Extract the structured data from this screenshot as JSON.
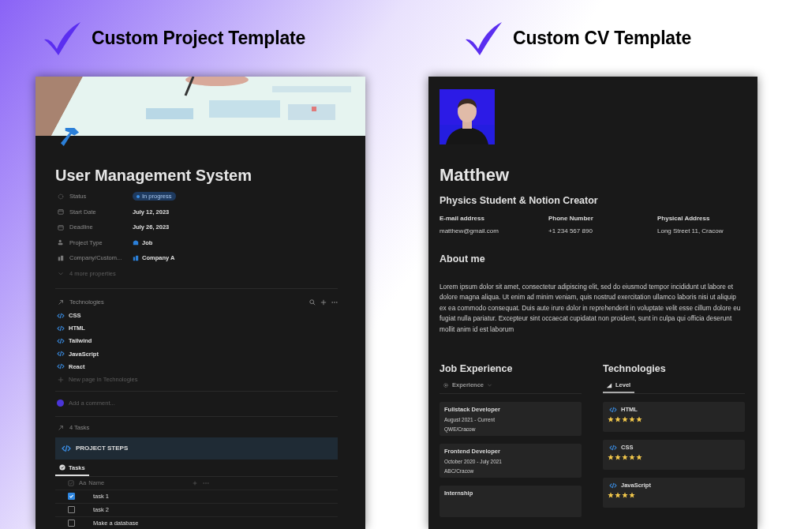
{
  "headings": [
    "Custom Project Template",
    "Custom CV Template"
  ],
  "project": {
    "title": "User Management System",
    "properties": [
      {
        "kind": "status",
        "label": "Status",
        "value": "In progress"
      },
      {
        "kind": "date",
        "label": "Start Date",
        "value": "July 12, 2023"
      },
      {
        "kind": "date",
        "label": "Deadline",
        "value": "July 26, 2023"
      },
      {
        "kind": "type",
        "label": "Project Type",
        "value": "Job"
      },
      {
        "kind": "company",
        "label": "Company/Custom...",
        "value": "Company A"
      }
    ],
    "more_properties": "4 more properties",
    "relation_title": "Technologies",
    "technologies": [
      "CSS",
      "HTML",
      "Tailwind",
      "JavaScript",
      "React"
    ],
    "new_page": "New page in Technologies",
    "comment_placeholder": "Add a comment...",
    "tasks_link": "4 Tasks",
    "callout": "PROJECT STEPS",
    "view_tab": {
      "label": "Tasks",
      "selected": true
    },
    "name_icon": "Aa",
    "name_column": "Name",
    "tasks": [
      {
        "name": "task 1",
        "checked": true
      },
      {
        "name": "task 2",
        "checked": false
      },
      {
        "name": "Make a database",
        "checked": false
      }
    ]
  },
  "cv": {
    "name": "Matthew",
    "subtitle": "Physics Student & Notion Creator",
    "contacts": [
      {
        "label": "E-mail address",
        "value": "matthew@gmail.com"
      },
      {
        "label": "Phone Number",
        "value": "+1 234 567 890"
      },
      {
        "label": "Physical Address",
        "value": "Long Street 11, Cracow"
      }
    ],
    "about_title": "About me",
    "about": "Lorem ipsum dolor sit amet, consectetur adipiscing elit, sed do eiusmod tempor incididunt ut labore et dolore magna aliqua. Ut enim ad minim veniam, quis nostrud exercitation ullamco laboris nisi ut aliquip ex ea commodo consequat. Duis aute irure dolor in reprehenderit in voluptate velit esse cillum dolore eu fugiat nulla pariatur. Excepteur sint occaecat cupidatat non proident, sunt in culpa qui officia deserunt mollit anim id est laborum",
    "jobs_title": "Job Experience",
    "jobs_tab": {
      "label": "Experience",
      "selected": false
    },
    "jobs": [
      {
        "title": "Fullstack Developer",
        "period": "August 2021 - Current",
        "place": "QWE/Cracow"
      },
      {
        "title": "Frontend Developer",
        "period": "October 2020 - July 2021",
        "place": "ABC/Cracow"
      },
      {
        "title": "Internship"
      }
    ],
    "tech_title": "Technologies",
    "tech_tab": {
      "label": "Level",
      "selected": true
    },
    "techs": [
      {
        "name": "HTML",
        "stars": 5
      },
      {
        "name": "CSS",
        "stars": 5
      },
      {
        "name": "JavaScript",
        "stars": 4
      }
    ]
  }
}
